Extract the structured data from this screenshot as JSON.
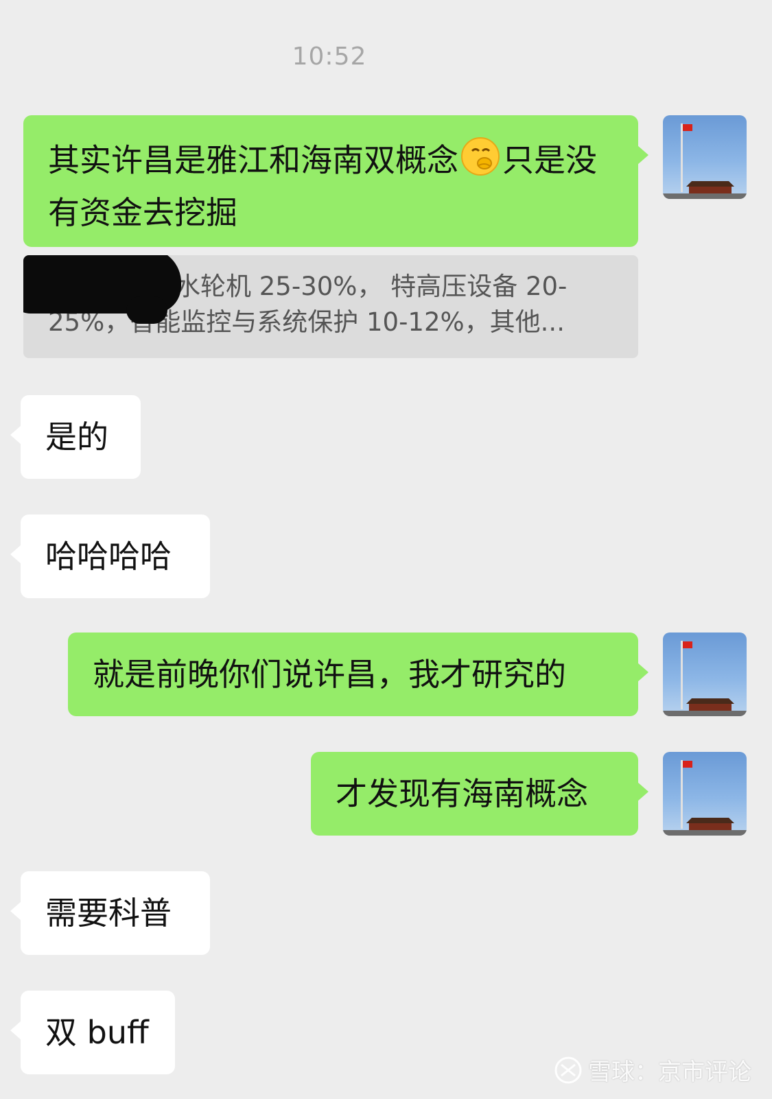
{
  "timestamp": "10:52",
  "messages": [
    {
      "sender": "me",
      "text_part1": "其实许昌是雅江和海南双概念",
      "emoji": "thinking-emoji",
      "text_part2": "只是没有资金去挖掘"
    },
    {
      "sender": "me",
      "type": "quote",
      "text": "电站设备：水轮机 25-30%， 特高压设备 20-25%，智能监控与系统保护 10-12%，其他..."
    },
    {
      "sender": "them",
      "text": "是的"
    },
    {
      "sender": "them",
      "text": "哈哈哈哈"
    },
    {
      "sender": "me",
      "text": "就是前晚你们说许昌，我才研究的"
    },
    {
      "sender": "me",
      "text": "才发现有海南概念"
    },
    {
      "sender": "them",
      "text": "需要科普"
    },
    {
      "sender": "them",
      "text": "双 buff"
    }
  ],
  "watermark": {
    "logo_icon": "snowball-logo",
    "text": "雪球：京市评论"
  },
  "colors": {
    "background": "#ededed",
    "my_bubble": "#95ec69",
    "their_bubble": "#ffffff",
    "quote_bubble": "#dcdcdc"
  }
}
